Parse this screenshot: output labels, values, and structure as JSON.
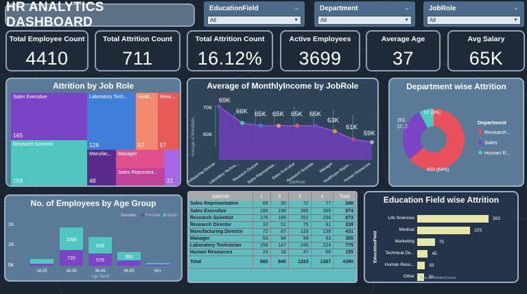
{
  "title": "HR ANALYTICS DASHBOARD",
  "slicers": [
    {
      "label": "EducationField",
      "value": "All"
    },
    {
      "label": "Department",
      "value": "All"
    },
    {
      "label": "JobRole",
      "value": "All"
    }
  ],
  "kpis": [
    {
      "label": "Total Employee Count",
      "value": "4410"
    },
    {
      "label": "Total Attrition Count",
      "value": "711"
    },
    {
      "label": "Total Attrition Count",
      "value": "16.12%"
    },
    {
      "label": "Active Employees",
      "value": "3699"
    },
    {
      "label": "Average Age",
      "value": "37"
    },
    {
      "label": "Avg Salary",
      "value": "65K"
    }
  ],
  "treemap": {
    "title": "Attrition by Job Role",
    "tiles": [
      {
        "name": "Sales Executive",
        "value": "165",
        "color": "#7b44c6"
      },
      {
        "name": "Research Scientist",
        "value": "159",
        "color": "#4fc7c0"
      },
      {
        "name": "Laboratory Tech...",
        "value": "126",
        "color": "#3f7fd9"
      },
      {
        "name": "Healt...",
        "value": "57",
        "color": "#f28a70"
      },
      {
        "name": "Rese...",
        "value": "57",
        "color": "#e65a5a"
      },
      {
        "name": "Manufac...",
        "value": "48",
        "color": "#5a2b8c"
      },
      {
        "name": "Manager",
        "value": "",
        "color": "#e24f8f"
      },
      {
        "name": "Sales Represent...",
        "value": "",
        "color": "#c04399"
      },
      {
        "name": "",
        "value": "21",
        "color": "#a966e6"
      }
    ]
  },
  "line_chart": {
    "title": "Average of MonthlyIncome by JobRole",
    "ylabel": "Average of MonthlyIn...",
    "xlabel": "JobRole",
    "ticks": [
      "70K",
      "60K"
    ],
    "roles": [
      "Manufacturing Director",
      "Laboratory Technic...",
      "Research Director",
      "Sales Representat...",
      "Sales Executive",
      "Research Scientist",
      "Manager",
      "Healthcare Repre...",
      "Human Resources"
    ],
    "labels": [
      "69K",
      "66K",
      "65K",
      "65K",
      "65K",
      "65K",
      "63K",
      "61K",
      "59K"
    ]
  },
  "donut": {
    "title": "Department wise Attrition",
    "legend_title": "Department",
    "legend": [
      {
        "name": "Research...",
        "color": "#e8505b"
      },
      {
        "name": "Sales",
        "color": "#7b44c6"
      },
      {
        "name": "Human R...",
        "color": "#4fc7c0"
      }
    ],
    "labels": [
      "57 (8%)",
      "201",
      "(2...)",
      "453 (64%)"
    ]
  },
  "age_chart": {
    "title": "No. of Employees by Age Group",
    "legend_title": "Gender",
    "legend": [
      {
        "name": "Female",
        "color": "#7b44c6"
      },
      {
        "name": "Male",
        "color": "#4fc7c0"
      }
    ],
    "ticks": [
      "2K",
      "1K",
      "0K"
    ],
    "xlabel": "Age Band",
    "groups": [
      {
        "label": "18-25",
        "female": "",
        "male": ""
      },
      {
        "label": "26-35",
        "female": "720",
        "male": "1098"
      },
      {
        "label": "36-45",
        "female": "576",
        "male": "828"
      },
      {
        "label": "46-55",
        "female": "",
        "male": "393"
      },
      {
        "label": "55+",
        "female": "",
        "male": ""
      }
    ]
  },
  "matrix": {
    "headers": [
      "JobRole",
      "1",
      "2",
      "3",
      "4",
      "Total"
    ],
    "rows": [
      [
        "Sales Representative",
        "69",
        "30",
        "72",
        "77",
        "248"
      ],
      [
        "Sales Executive",
        "186",
        "198",
        "285",
        "305",
        "974"
      ],
      [
        "Research Scientist",
        "176",
        "189",
        "252",
        "256",
        "873"
      ],
      [
        "Research Director",
        "32",
        "51",
        "75",
        "81",
        "239"
      ],
      [
        "Manufacturing Director",
        "72",
        "87",
        "133",
        "139",
        "431"
      ],
      [
        "Manager",
        "59",
        "54",
        "99",
        "93",
        "305"
      ],
      [
        "Laboratory Technician",
        "158",
        "147",
        "246",
        "224",
        "775"
      ],
      [
        "Human Resources",
        "24",
        "18",
        "47",
        "66",
        "155"
      ]
    ],
    "total": [
      "Total",
      "860",
      "840",
      "1323",
      "1367",
      "4390"
    ]
  },
  "edu_chart": {
    "title": "Education Field wise Attrition",
    "ylabel": "EducationField",
    "xlabel": "Sum of AttritionCount",
    "rows": [
      {
        "label": "Life Sciences",
        "value": 303
      },
      {
        "label": "Medical",
        "value": 225
      },
      {
        "label": "Marketing",
        "value": 75
      },
      {
        "label": "Technical De...",
        "value": 45
      },
      {
        "label": "Human Reso...",
        "value": 33
      },
      {
        "label": "Other",
        "value": 30
      }
    ]
  }
}
